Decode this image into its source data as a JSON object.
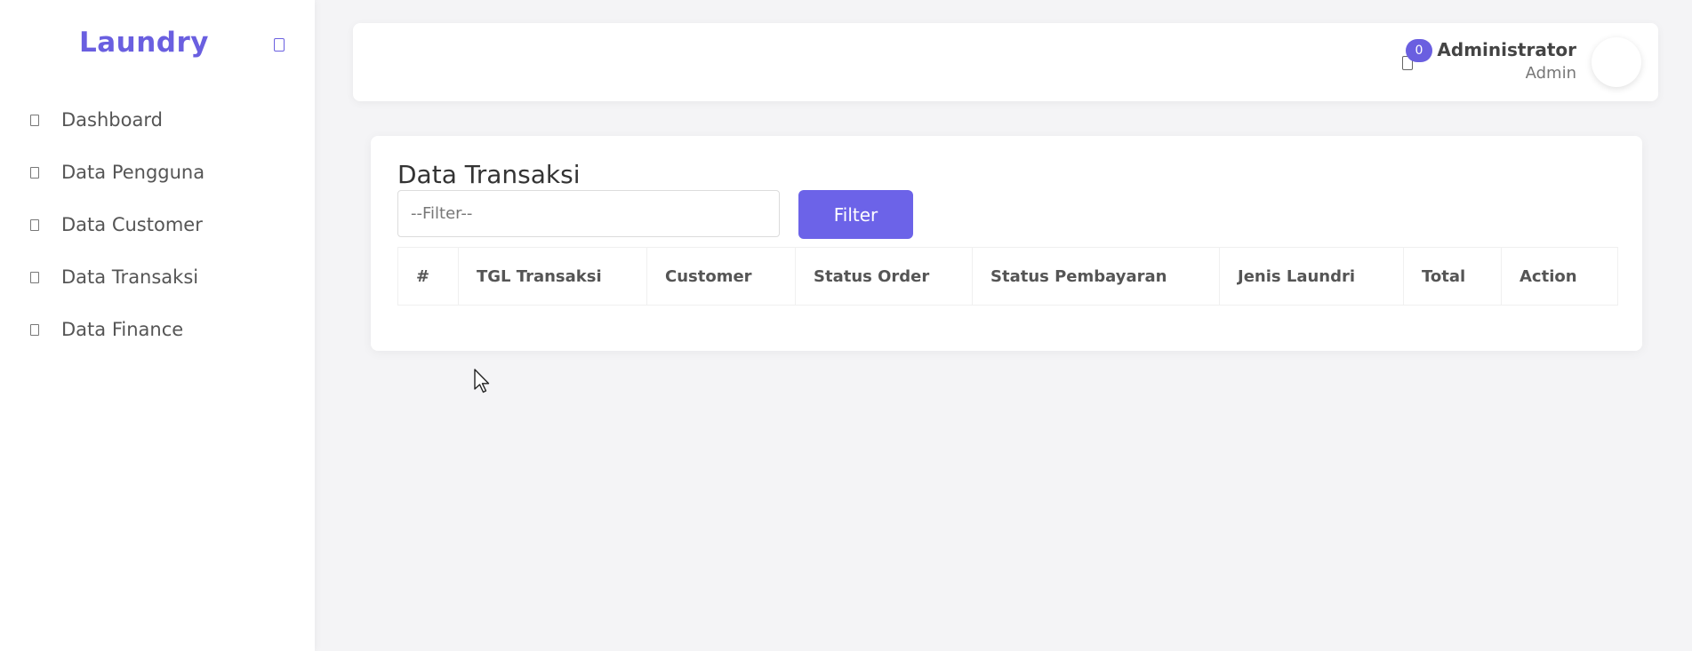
{
  "sidebar": {
    "brand": "Laundry",
    "toggle_icon": "menu-toggle-icon",
    "items": [
      {
        "label": "Dashboard",
        "icon": "dashboard-icon"
      },
      {
        "label": "Data Pengguna",
        "icon": "users-icon"
      },
      {
        "label": "Data Customer",
        "icon": "customer-icon"
      },
      {
        "label": "Data Transaksi",
        "icon": "transaction-icon"
      },
      {
        "label": "Data Finance",
        "icon": "finance-icon"
      }
    ]
  },
  "topbar": {
    "notification_icon": "bell-icon",
    "notification_count": "0",
    "user_name": "Administrator",
    "user_role": "Admin"
  },
  "main": {
    "title": "Data Transaksi",
    "filter": {
      "placeholder": "--Filter--",
      "value": "",
      "button_label": "Filter"
    },
    "table": {
      "columns": [
        "#",
        "TGL Transaksi",
        "Customer",
        "Status Order",
        "Status Pembayaran",
        "Jenis Laundri",
        "Total",
        "Action"
      ],
      "rows": []
    }
  },
  "colors": {
    "accent": "#6a5fe0",
    "button": "#6c63e8",
    "background": "#f4f4f6",
    "card": "#ffffff"
  }
}
